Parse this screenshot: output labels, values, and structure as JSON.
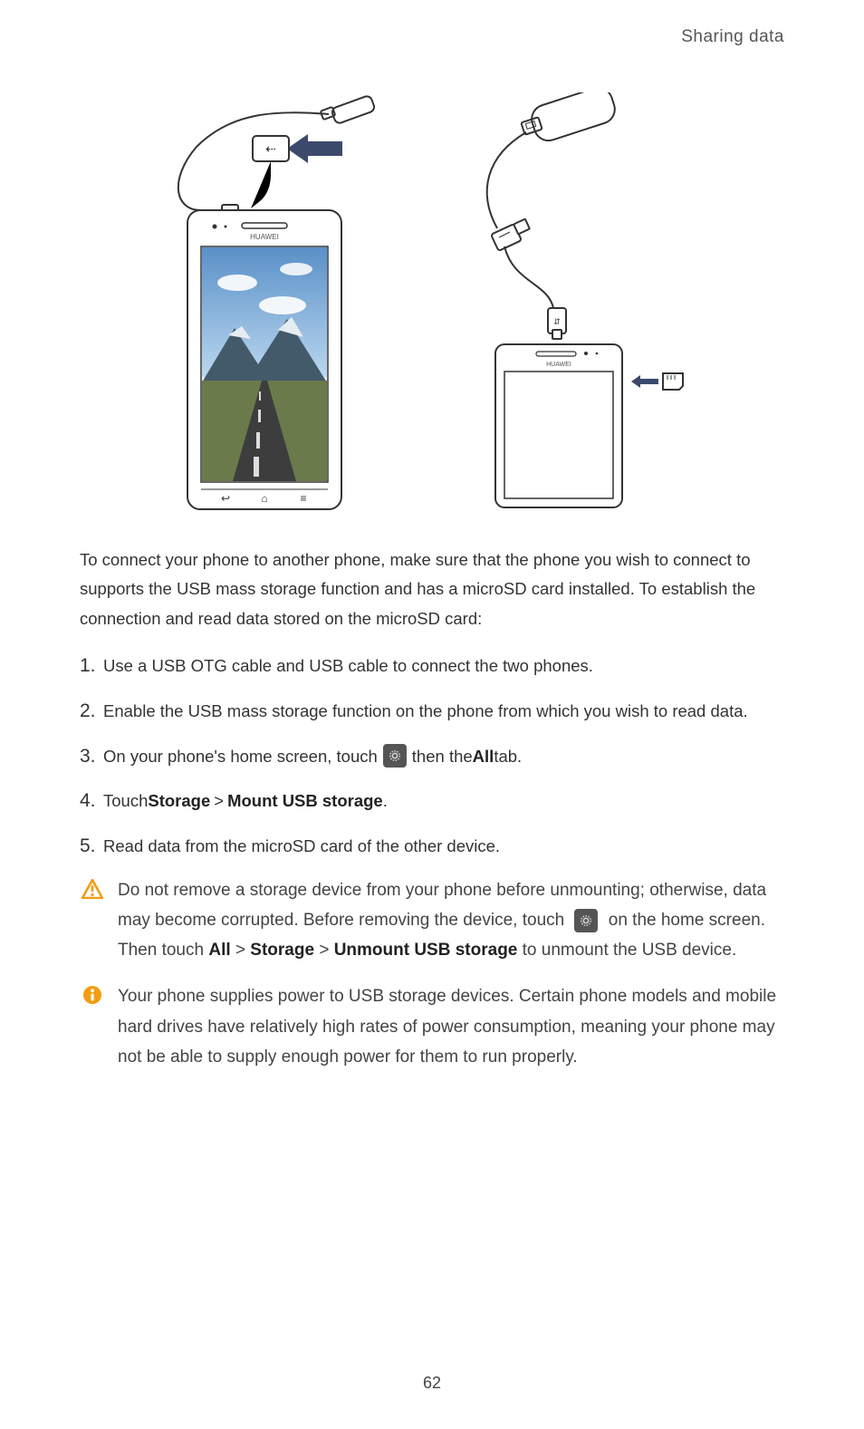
{
  "header": {
    "breadcrumb": "Sharing data"
  },
  "intro": "To connect your phone to another phone, make sure that the phone you wish to connect to supports the USB mass storage function and has a microSD card installed. To establish the connection and read data stored on the microSD card:",
  "steps": [
    {
      "num": "1.",
      "text": "Use a USB OTG cable and USB cable to connect the two phones."
    },
    {
      "num": "2.",
      "text": "Enable the USB mass storage function on the phone from which you wish to read data."
    },
    {
      "num": "3.",
      "pre": "On your phone's home screen, touch ",
      "post_pre": " then the ",
      "bold": "All",
      "post": " tab."
    },
    {
      "num": "4.",
      "pre": "Touch ",
      "bold1": "Storage",
      "sep": " > ",
      "bold2": "Mount USB storage",
      "post": "."
    },
    {
      "num": "5.",
      "text": "Read data from the microSD card of the other device."
    }
  ],
  "warning": {
    "line1": "Do not remove a storage device from your phone before unmounting; otherwise, data may become corrupted. Before removing the device, touch ",
    "line2_pre": " on the home screen. Then touch ",
    "b_all": "All",
    "sep1": " > ",
    "b_storage": "Storage",
    "sep2": " > ",
    "b_unmount": "Unmount USB storage",
    "line2_post": " to unmount the USB device."
  },
  "info": "Your phone supplies power to USB storage devices. Certain phone models and mobile hard drives have relatively high rates of power consumption, meaning your phone may not be able to supply enough power for them to run properly.",
  "page_number": "62"
}
